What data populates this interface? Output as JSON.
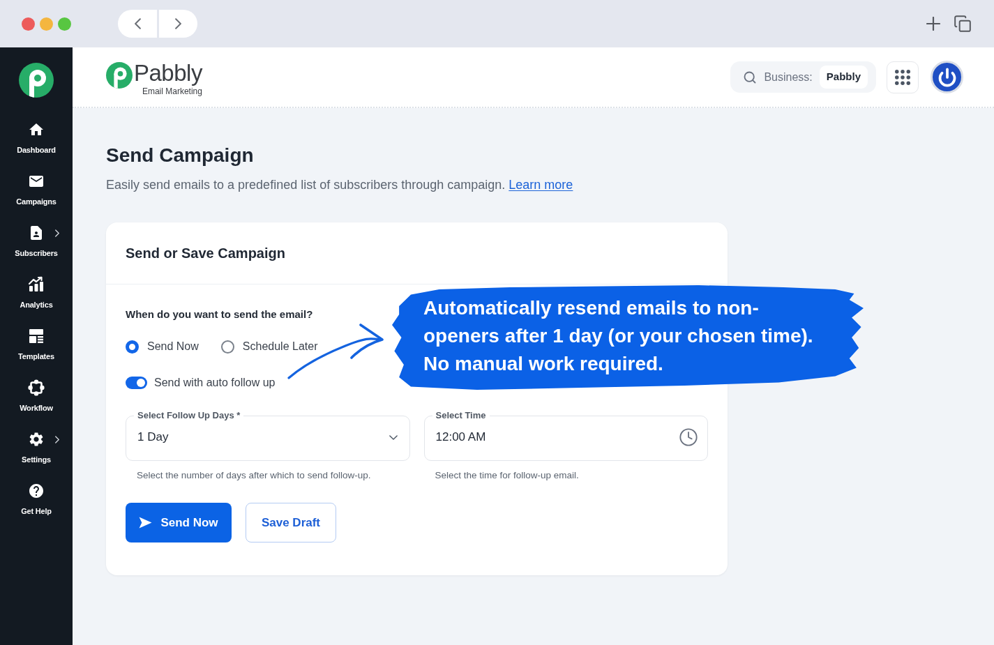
{
  "sidebar": {
    "items": [
      {
        "label": "Dashboard",
        "has_submenu": false
      },
      {
        "label": "Campaigns",
        "has_submenu": false
      },
      {
        "label": "Subscribers",
        "has_submenu": true
      },
      {
        "label": "Analytics",
        "has_submenu": false
      },
      {
        "label": "Templates",
        "has_submenu": false
      },
      {
        "label": "Workflow",
        "has_submenu": false
      },
      {
        "label": "Settings",
        "has_submenu": true
      },
      {
        "label": "Get Help",
        "has_submenu": false
      }
    ]
  },
  "header": {
    "logo": {
      "name": "Pabbly",
      "tagline": "Email Marketing"
    },
    "business_switcher": {
      "label": "Business:",
      "value": "Pabbly"
    }
  },
  "page": {
    "title": "Send Campaign",
    "description": "Easily send emails to a predefined list of subscribers through campaign.",
    "link": "Learn more"
  },
  "card": {
    "title": "Send or Save Campaign",
    "question": "When do you want to send the email?",
    "send_options": [
      {
        "label": "Send Now",
        "selected": true
      },
      {
        "label": "Schedule Later",
        "selected": false
      }
    ],
    "auto_follow_up": {
      "label": "Send with auto follow up",
      "on": true
    },
    "fields": [
      {
        "kind": "select",
        "label": "Select Follow Up Days *",
        "value": "1 Day",
        "helper": "Select the number of days after which to send follow-up."
      },
      {
        "kind": "time",
        "label": "Select Time",
        "value": "12:00 AM",
        "helper": "Select the time for follow-up email."
      }
    ],
    "buttons": [
      {
        "kind": "primary",
        "label": "Send Now"
      },
      {
        "kind": "secondary",
        "label": "Save Draft"
      }
    ]
  },
  "callout": {
    "text": "Automatically resend emails to non-openers after 1 day (or your chosen time). No manual work required."
  }
}
